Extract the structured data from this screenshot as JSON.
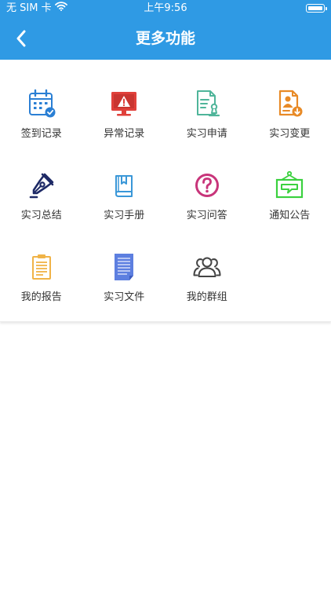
{
  "status_bar": {
    "carrier": "无 SIM 卡",
    "time": "上午9:56"
  },
  "nav": {
    "title": "更多功能"
  },
  "colors": {
    "header": "#2f9ae4",
    "blue": "#2a7fd4",
    "red": "#e0403a",
    "teal": "#4fb59a",
    "orange": "#e88a26",
    "navy": "#1e2a66",
    "sky": "#3a97d8",
    "magenta": "#c8347a",
    "green": "#3bd13f",
    "amber": "#f0b347",
    "indigo": "#5d7fe0",
    "gray": "#444444"
  },
  "menu": [
    {
      "label": "签到记录",
      "icon": "calendar-check-icon"
    },
    {
      "label": "异常记录",
      "icon": "monitor-warning-icon"
    },
    {
      "label": "实习申请",
      "icon": "document-stamp-icon"
    },
    {
      "label": "实习变更",
      "icon": "profile-change-icon"
    },
    {
      "label": "实习总结",
      "icon": "pen-nib-icon"
    },
    {
      "label": "实习手册",
      "icon": "handbook-icon"
    },
    {
      "label": "实习问答",
      "icon": "question-circle-icon"
    },
    {
      "label": "通知公告",
      "icon": "notice-board-icon"
    },
    {
      "label": "我的报告",
      "icon": "clipboard-report-icon"
    },
    {
      "label": "实习文件",
      "icon": "file-icon"
    },
    {
      "label": "我的群组",
      "icon": "group-icon"
    }
  ]
}
